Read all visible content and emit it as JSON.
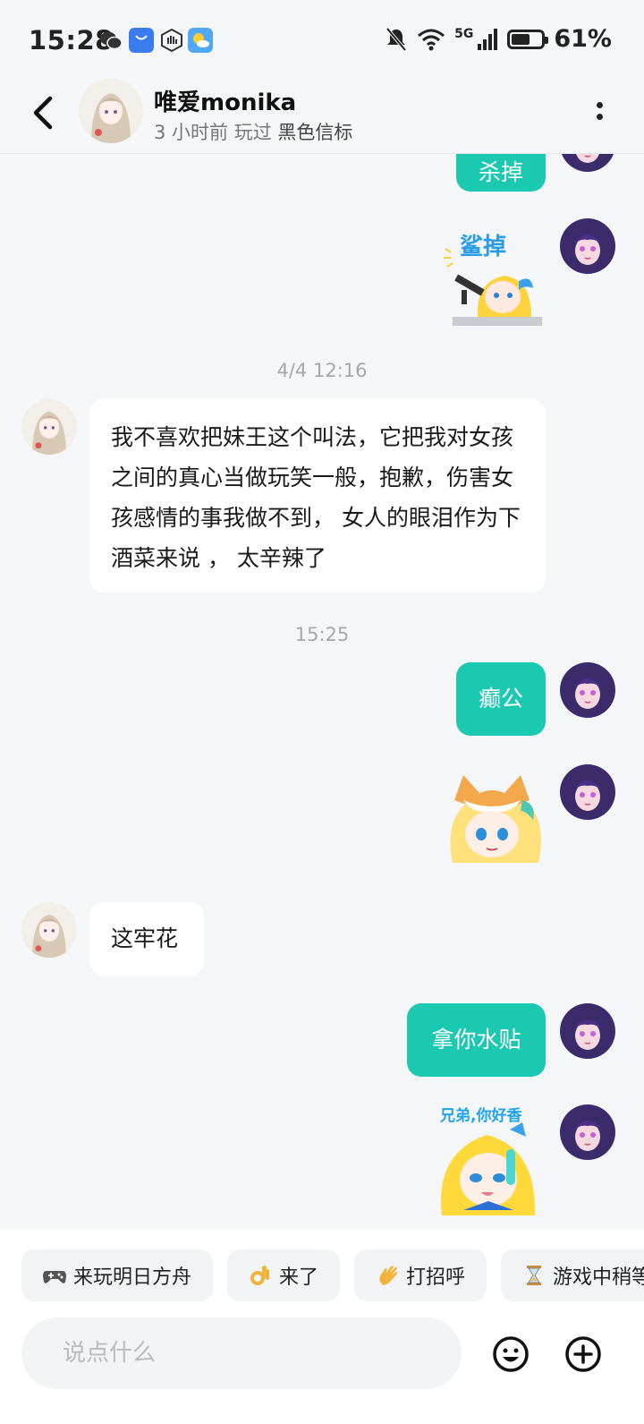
{
  "status_bar": {
    "time": "15:28",
    "network": "5G",
    "battery_text": "61%",
    "battery_level": 0.61
  },
  "header": {
    "name": "唯爱monika",
    "sub_time": "3 小时前 玩过",
    "sub_game": "黑色信标"
  },
  "messages": {
    "partial_bubble": "杀掉",
    "sticker1_caption": "鲨掉",
    "timestamp1": "4/4  12:16",
    "msg_long": "我不喜欢把妹王这个叫法，它把我对女孩之间的真心当做玩笑一般，抱歉，伤害女孩感情的事我做不到， 女人的眼泪作为下酒菜来说 ， 太辛辣了",
    "timestamp2": "15:25",
    "msg_mine1": "癫公",
    "msg_theirs2": "这牢花",
    "msg_mine2": "拿你水贴",
    "sticker3_caption": "兄弟,你好香"
  },
  "quick_replies": [
    {
      "icon": "gamepad-icon",
      "label": "来玩明日方舟"
    },
    {
      "icon": "ok-hand-icon",
      "label": "来了"
    },
    {
      "icon": "wave-icon",
      "label": "打招呼"
    },
    {
      "icon": "hourglass-icon",
      "label": "游戏中稍等"
    }
  ],
  "input": {
    "placeholder": "说点什么"
  },
  "colors": {
    "accent": "#1bc8b0",
    "background": "#f5f6f8",
    "bubble_theirs": "#ffffff"
  }
}
